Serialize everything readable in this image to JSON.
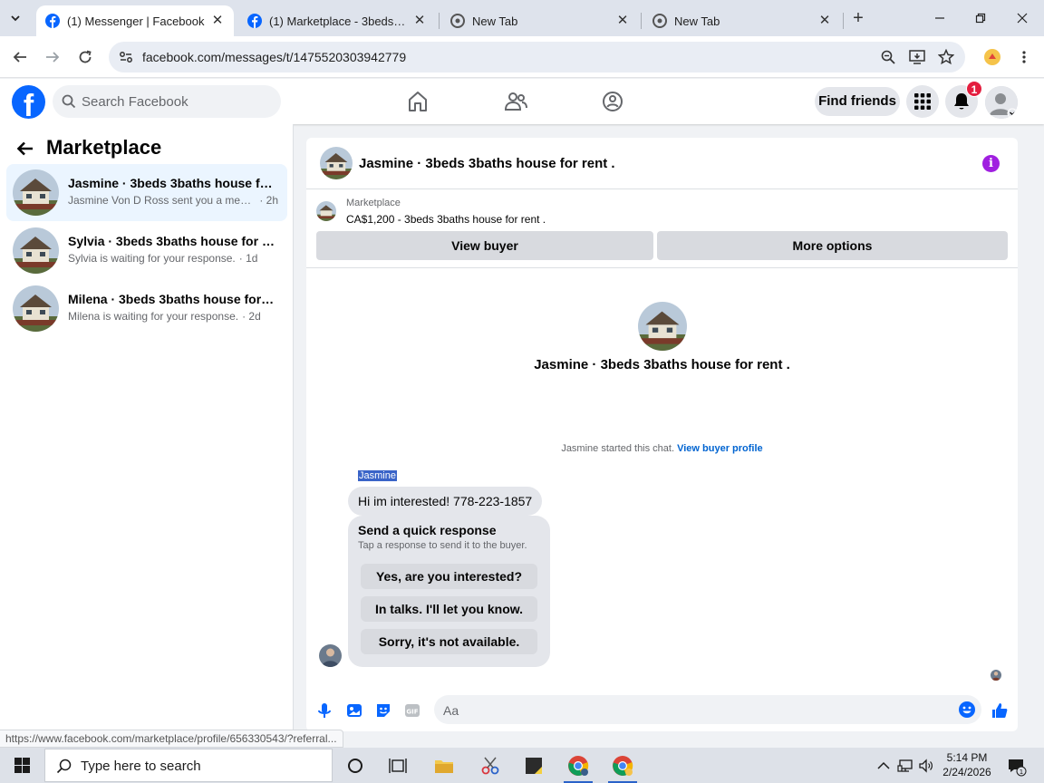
{
  "browser": {
    "tabs": [
      {
        "title": "(1) Messenger | Facebook",
        "icon": "facebook-icon",
        "active": true
      },
      {
        "title": "(1) Marketplace - 3beds 3baths",
        "icon": "facebook-icon",
        "active": false
      },
      {
        "title": "New Tab",
        "icon": "chrome-icon",
        "active": false
      },
      {
        "title": "New Tab",
        "icon": "chrome-icon",
        "active": false
      }
    ],
    "url": "facebook.com/messages/t/1475520303942779"
  },
  "facebook": {
    "logo": "f",
    "search_placeholder": "Search Facebook",
    "find_friends": "Find friends",
    "notification_count": "1"
  },
  "sidebar": {
    "title": "Marketplace",
    "conversations": [
      {
        "name": "Jasmine · 3beds 3baths house for rent .",
        "preview": "Jasmine Von D Ross sent you a message.",
        "time": "· 2h",
        "selected": true
      },
      {
        "name": "Sylvia · 3beds 3baths house for rent .",
        "preview": "Sylvia is waiting for your response.",
        "time": "· 1d",
        "selected": false
      },
      {
        "name": "Milena · 3beds 3baths house for rent .",
        "preview": "Milena is waiting for your response.",
        "time": "· 2d",
        "selected": false
      }
    ]
  },
  "chat": {
    "header_name": "Jasmine · 3beds 3baths house for rent .",
    "marketplace_label": "Marketplace",
    "listing": "CA$1,200 - 3beds 3baths house for rent .",
    "view_buyer": "View buyer",
    "more_options": "More options",
    "intro_name": "Jasmine · 3beds 3baths house for rent .",
    "started_text": "Jasmine started this chat.",
    "view_buyer_profile": "View buyer profile",
    "sender": "Jasmine",
    "message": "Hi im interested! 778-223-1857",
    "quick_title": "Send a quick response",
    "quick_subtitle": "Tap a response to send it to the buyer.",
    "quick_replies": [
      "Yes, are you interested?",
      "In talks. I'll let you know.",
      "Sorry, it's not available."
    ],
    "composer_placeholder": "Aa"
  },
  "status_url": "https://www.facebook.com/marketplace/profile/656330543/?referral...",
  "taskbar": {
    "search_placeholder": "Type here to search",
    "time": "5:14 PM",
    "date": "2/24/2026"
  },
  "colors": {
    "facebook_blue": "#0866ff",
    "selected_row": "#ebf5ff",
    "info_purple": "#a01fe0",
    "badge_red": "#e41e3f"
  }
}
